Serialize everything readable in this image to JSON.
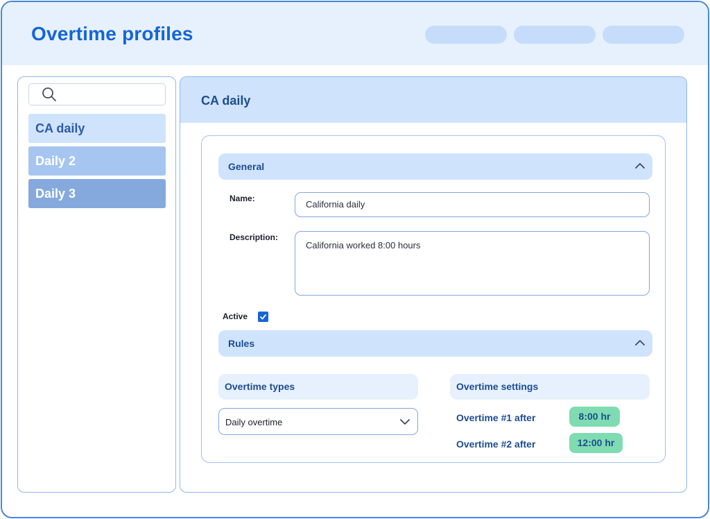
{
  "app": {
    "title": "Overtime profiles"
  },
  "sidebar": {
    "search": {
      "placeholder": ""
    },
    "items": [
      {
        "label": "CA daily"
      },
      {
        "label": "Daily 2"
      },
      {
        "label": "Daily 3"
      }
    ]
  },
  "detail": {
    "title": "CA daily",
    "general": {
      "section_label": "General",
      "name_label": "Name:",
      "name_value": "California daily",
      "description_label": "Description:",
      "description_value": "California worked 8:00 hours",
      "active_label": "Active",
      "active_checked": true
    },
    "rules": {
      "section_label": "Rules",
      "types_heading": "Overtime types",
      "types_selected": "Daily overtime",
      "settings_heading": "Overtime settings",
      "settings": [
        {
          "label": "Overtime #1 after",
          "value": "8:00 hr"
        },
        {
          "label": "Overtime #2 after",
          "value": "12:00 hr"
        }
      ]
    }
  },
  "colors": {
    "accent": "#1565d8",
    "header_bg": "#e6f1fd",
    "section_bg": "#cfe3fc",
    "badge_green": "#7fdcb2"
  },
  "icons": {
    "search": "search-icon",
    "collapse": "chevron-up-icon",
    "dropdown": "chevron-down-icon",
    "check": "check-icon"
  }
}
